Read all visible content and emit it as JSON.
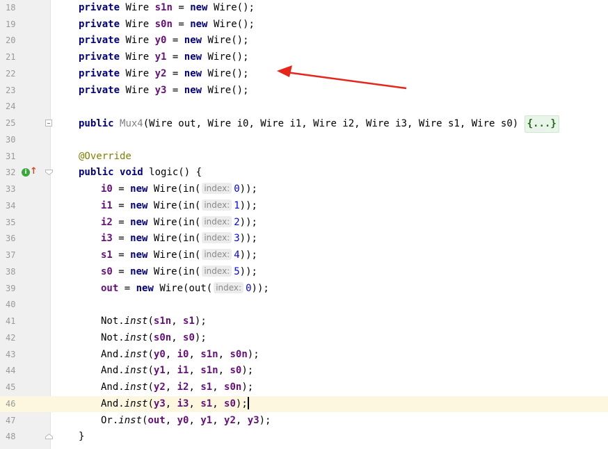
{
  "editor": {
    "lines": [
      {
        "num": "18",
        "decl": {
          "name": "s1n"
        }
      },
      {
        "num": "19",
        "decl": {
          "name": "s0n"
        }
      },
      {
        "num": "20",
        "decl": {
          "name": "y0"
        }
      },
      {
        "num": "21",
        "decl": {
          "name": "y1"
        }
      },
      {
        "num": "22",
        "decl": {
          "name": "y2"
        }
      },
      {
        "num": "23",
        "decl": {
          "name": "y3"
        }
      },
      {
        "num": "24"
      },
      {
        "num": "25",
        "ctor": {
          "kw": "public",
          "name": "Mux4",
          "params": "(Wire out, Wire i0, Wire i1, Wire i2, Wire i3, Wire s1, Wire s0)",
          "folded": "{...}"
        }
      },
      {
        "num": "30"
      },
      {
        "num": "31",
        "annotation": "@Override"
      },
      {
        "num": "32",
        "method": {
          "kw1": "public",
          "kw2": "void",
          "rest": " logic() {"
        }
      },
      {
        "num": "33",
        "assign": {
          "var": "i0",
          "call": "in(",
          "hint": "index:",
          "value": "0"
        }
      },
      {
        "num": "34",
        "assign": {
          "var": "i1",
          "call": "in(",
          "hint": "index:",
          "value": "1"
        }
      },
      {
        "num": "35",
        "assign": {
          "var": "i2",
          "call": "in(",
          "hint": "index:",
          "value": "2"
        }
      },
      {
        "num": "36",
        "assign": {
          "var": "i3",
          "call": "in(",
          "hint": "index:",
          "value": "3"
        }
      },
      {
        "num": "37",
        "assign": {
          "var": "s1",
          "call": "in(",
          "hint": "index:",
          "value": "4"
        }
      },
      {
        "num": "38",
        "assign": {
          "var": "s0",
          "call": "in(",
          "hint": "index:",
          "value": "5"
        }
      },
      {
        "num": "39",
        "assign": {
          "var": "out",
          "call": "out(",
          "hint": "index:",
          "value": "0"
        }
      },
      {
        "num": "40"
      },
      {
        "num": "41",
        "inst": {
          "cls": "Not",
          "args": [
            "s1n",
            "s1"
          ]
        }
      },
      {
        "num": "42",
        "inst": {
          "cls": "Not",
          "args": [
            "s0n",
            "s0"
          ]
        }
      },
      {
        "num": "43",
        "inst": {
          "cls": "And",
          "args": [
            "y0",
            "i0",
            "s1n",
            "s0n"
          ]
        }
      },
      {
        "num": "44",
        "inst": {
          "cls": "And",
          "args": [
            "y1",
            "i1",
            "s1n",
            "s0"
          ]
        }
      },
      {
        "num": "45",
        "inst": {
          "cls": "And",
          "args": [
            "y2",
            "i2",
            "s1",
            "s0n"
          ]
        }
      },
      {
        "num": "46",
        "inst": {
          "cls": "And",
          "args": [
            "y3",
            "i3",
            "s1",
            "s0"
          ]
        },
        "current": true
      },
      {
        "num": "47",
        "inst": {
          "cls": "Or",
          "args": [
            "out",
            "y0",
            "y1",
            "y2",
            "y3"
          ]
        }
      },
      {
        "num": "48",
        "close": "}"
      }
    ],
    "tokens": {
      "private": "private",
      "type": "Wire",
      "eq": "=",
      "new": "new",
      "ctor_call": "Wire()",
      "semi": ";",
      "wire_open": "Wire(",
      "close_call": "));",
      "method": "inst",
      "dot": "."
    },
    "icons": {
      "override": "override-method-icon",
      "goto_super": "up-arrow-icon"
    },
    "annotation_arrow_color": "#e8251b"
  }
}
